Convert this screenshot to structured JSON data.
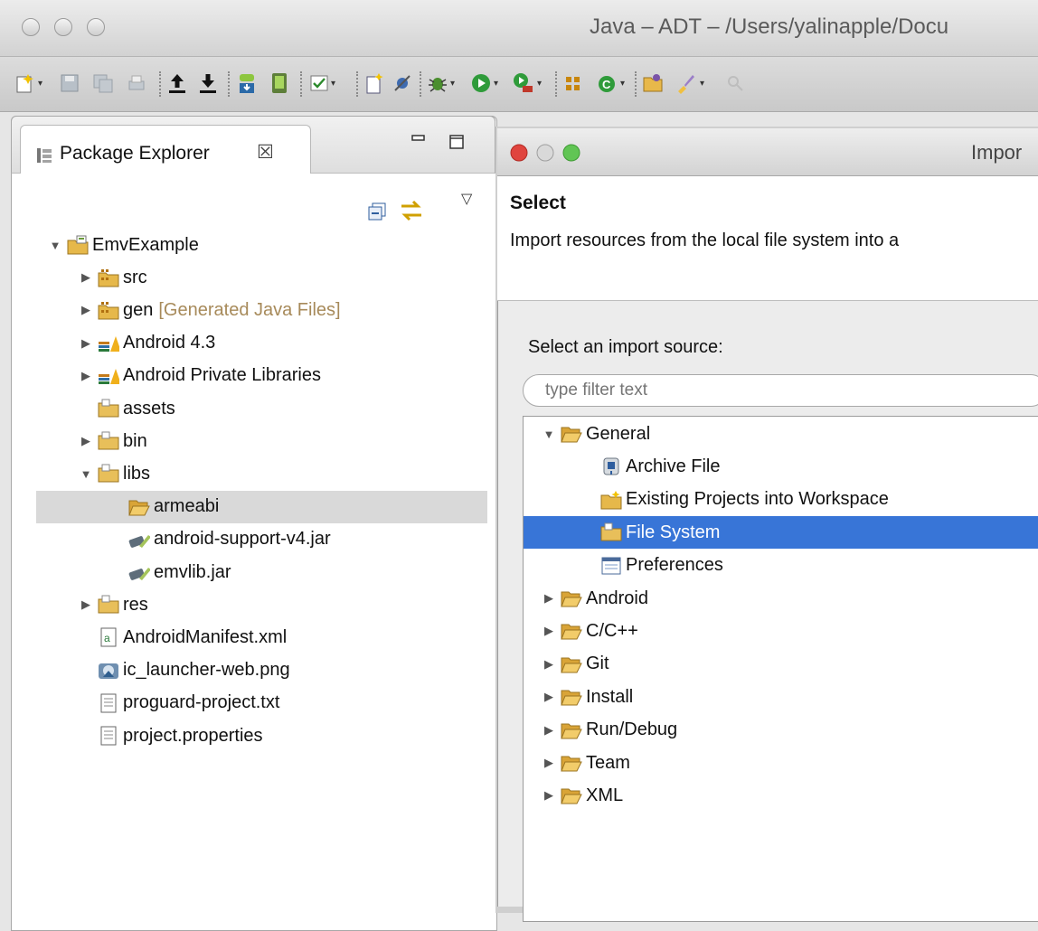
{
  "window": {
    "title": "Java – ADT – /Users/yalinapple/Docu"
  },
  "package_explorer": {
    "tab_label": "Package Explorer",
    "close_glyph": "☒",
    "tree": [
      {
        "label": "EmvExample",
        "indent": 0,
        "arrow": "▼",
        "icon": "project-icon"
      },
      {
        "label": "src",
        "indent": 1,
        "arrow": "▶",
        "icon": "source-folder-icon"
      },
      {
        "label": "gen",
        "decoration": "[Generated Java Files]",
        "indent": 1,
        "arrow": "▶",
        "icon": "source-folder-icon"
      },
      {
        "label": "Android 4.3",
        "indent": 1,
        "arrow": "▶",
        "icon": "library-icon"
      },
      {
        "label": "Android Private Libraries",
        "indent": 1,
        "arrow": "▶",
        "icon": "library-icon"
      },
      {
        "label": "assets",
        "indent": 1,
        "arrow": "",
        "icon": "folder-icon"
      },
      {
        "label": "bin",
        "indent": 1,
        "arrow": "▶",
        "icon": "folder-icon"
      },
      {
        "label": "libs",
        "indent": 1,
        "arrow": "▼",
        "icon": "folder-icon"
      },
      {
        "label": "armeabi",
        "indent": 2,
        "arrow": "",
        "icon": "open-folder-icon",
        "selected": true
      },
      {
        "label": "android-support-v4.jar",
        "indent": 2,
        "arrow": "",
        "icon": "jar-icon"
      },
      {
        "label": "emvlib.jar",
        "indent": 2,
        "arrow": "",
        "icon": "jar-icon"
      },
      {
        "label": "res",
        "indent": 1,
        "arrow": "▶",
        "icon": "folder-icon"
      },
      {
        "label": "AndroidManifest.xml",
        "indent": 1,
        "arrow": "",
        "icon": "xml-file-icon"
      },
      {
        "label": "ic_launcher-web.png",
        "indent": 1,
        "arrow": "",
        "icon": "image-file-icon"
      },
      {
        "label": "proguard-project.txt",
        "indent": 1,
        "arrow": "",
        "icon": "text-file-icon"
      },
      {
        "label": "project.properties",
        "indent": 1,
        "arrow": "",
        "icon": "text-file-icon"
      }
    ]
  },
  "import_dialog": {
    "title": "Impor",
    "header_title": "Select",
    "header_desc": "Import resources from the local file system into a",
    "source_label": "Select an import source:",
    "filter_placeholder": "type filter text",
    "wizards": [
      {
        "label": "General",
        "indent": 0,
        "arrow": "▼",
        "icon": "open-folder-icon"
      },
      {
        "label": "Archive File",
        "indent": 1,
        "arrow": "",
        "icon": "archive-icon"
      },
      {
        "label": "Existing Projects into Workspace",
        "indent": 1,
        "arrow": "",
        "icon": "existing-project-icon"
      },
      {
        "label": "File System",
        "indent": 1,
        "arrow": "",
        "icon": "folder-icon",
        "selected": true
      },
      {
        "label": "Preferences",
        "indent": 1,
        "arrow": "",
        "icon": "preferences-icon"
      },
      {
        "label": "Android",
        "indent": 0,
        "arrow": "▶",
        "icon": "open-folder-icon"
      },
      {
        "label": "C/C++",
        "indent": 0,
        "arrow": "▶",
        "icon": "open-folder-icon"
      },
      {
        "label": "Git",
        "indent": 0,
        "arrow": "▶",
        "icon": "open-folder-icon"
      },
      {
        "label": "Install",
        "indent": 0,
        "arrow": "▶",
        "icon": "open-folder-icon"
      },
      {
        "label": "Run/Debug",
        "indent": 0,
        "arrow": "▶",
        "icon": "open-folder-icon"
      },
      {
        "label": "Team",
        "indent": 0,
        "arrow": "▶",
        "icon": "open-folder-icon"
      },
      {
        "label": "XML",
        "indent": 0,
        "arrow": "▶",
        "icon": "open-folder-icon"
      }
    ]
  },
  "colors": {
    "selection": "#3875d7",
    "tree_selection": "#d9d9d9"
  }
}
